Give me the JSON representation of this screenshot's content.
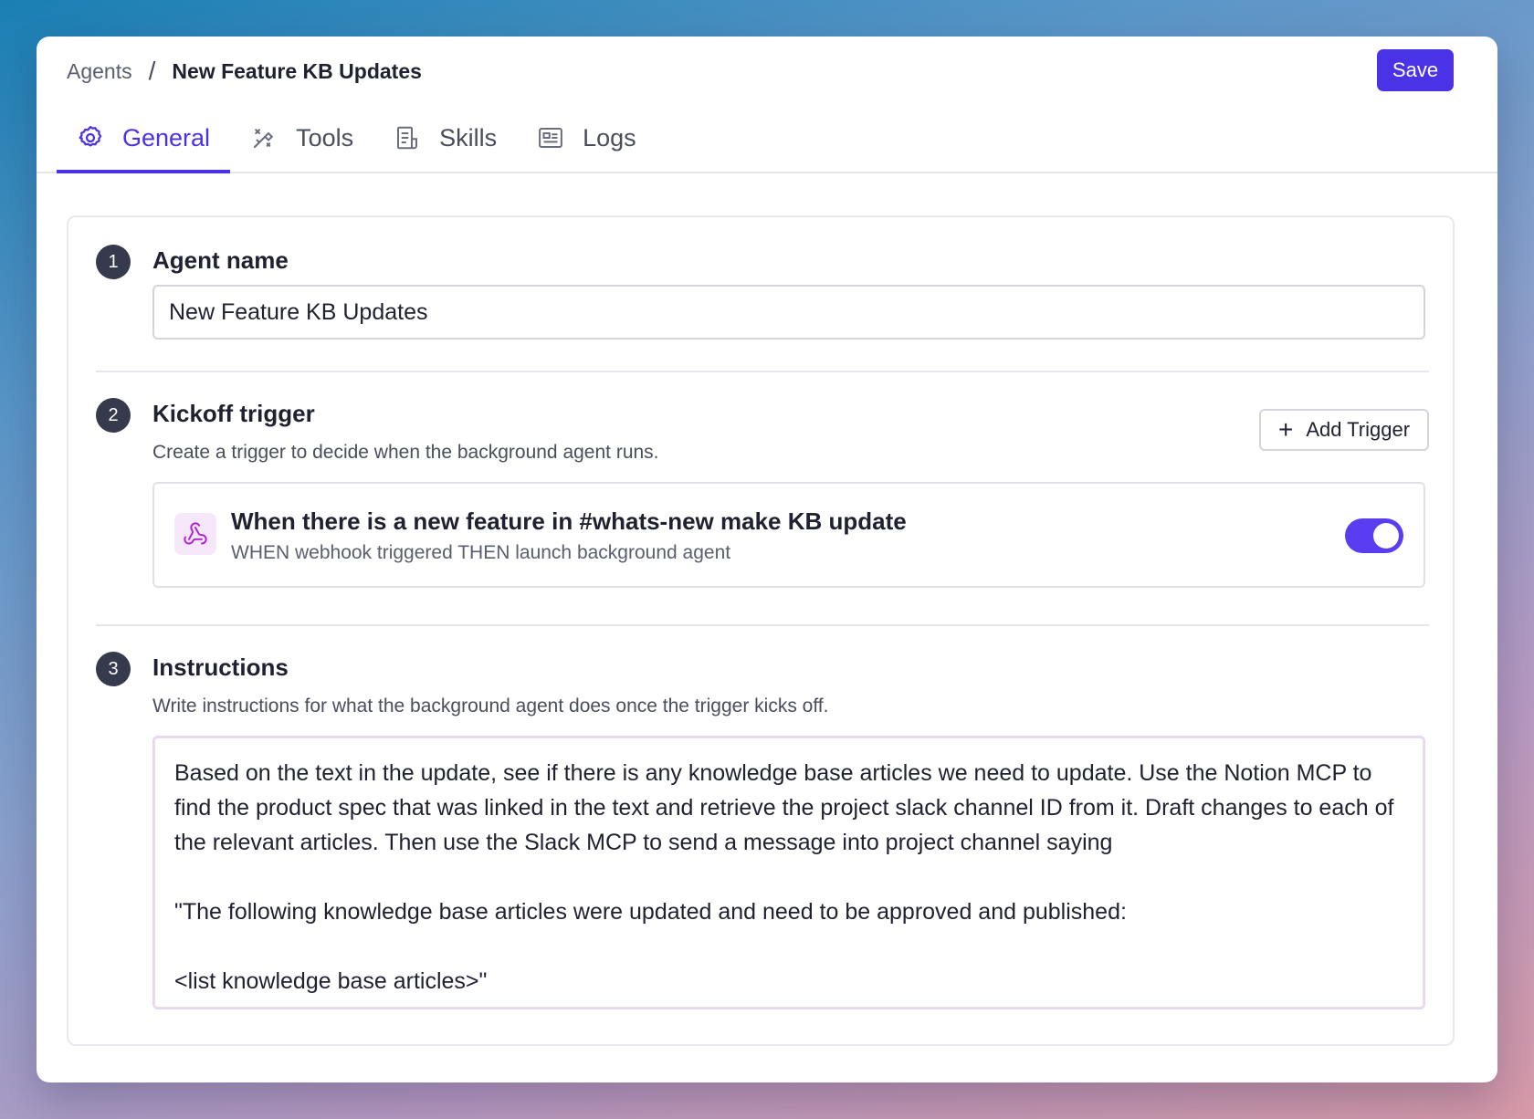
{
  "breadcrumb": {
    "parent": "Agents",
    "separator": "/",
    "current": "New Feature KB Updates"
  },
  "toolbar": {
    "save_label": "Save"
  },
  "tabs": [
    {
      "label": "General",
      "icon": "gear-icon",
      "active": true
    },
    {
      "label": "Tools",
      "icon": "tools-icon",
      "active": false
    },
    {
      "label": "Skills",
      "icon": "document-icon",
      "active": false
    },
    {
      "label": "Logs",
      "icon": "logs-icon",
      "active": false
    }
  ],
  "sections": {
    "agent_name": {
      "number": "1",
      "title": "Agent name",
      "value": "New Feature KB Updates"
    },
    "kickoff": {
      "number": "2",
      "title": "Kickoff trigger",
      "description": "Create a trigger to decide when the background agent runs.",
      "add_label": "Add Trigger",
      "trigger": {
        "title": "When there is a new feature in #whats-new make KB update",
        "subtitle": "WHEN webhook triggered THEN launch background agent",
        "icon": "webhook-icon",
        "enabled": true
      }
    },
    "instructions": {
      "number": "3",
      "title": "Instructions",
      "description": "Write instructions for what the background agent does once the trigger kicks off.",
      "value": "Based on the text in the update, see if there is any knowledge base articles we need to update. Use the Notion MCP to find the product spec that was linked in the text and retrieve the project slack channel ID from it. Draft changes to each of the relevant articles. Then use the Slack MCP to send a message into project channel saying\n\n\"The following knowledge base articles were updated and need to be approved and published:\n\n<list knowledge base articles>\""
    }
  },
  "colors": {
    "accent": "#4a32e6",
    "toggle_on": "#5a3df0",
    "step_badge": "#363a4d",
    "webhook_icon": "#b21fd6"
  }
}
